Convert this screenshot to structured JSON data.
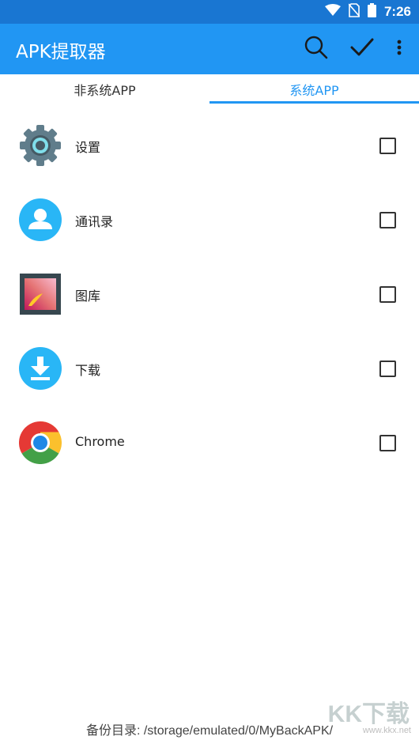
{
  "status_bar": {
    "time": "7:26"
  },
  "app_bar": {
    "title": "APK提取器"
  },
  "tabs": [
    {
      "label": "非系统APP",
      "active": false
    },
    {
      "label": "系统APP",
      "active": true
    }
  ],
  "apps": [
    {
      "name": "设置",
      "icon": "settings-icon",
      "checked": false
    },
    {
      "name": "通讯录",
      "icon": "contacts-icon",
      "checked": false
    },
    {
      "name": "图库",
      "icon": "gallery-icon",
      "checked": false
    },
    {
      "name": "下载",
      "icon": "download-icon",
      "checked": false
    },
    {
      "name": "Chrome",
      "icon": "chrome-icon",
      "checked": false
    }
  ],
  "footer": {
    "backup_dir": "备份目录: /storage/emulated/0/MyBackAPK/"
  },
  "watermark": {
    "big": "KK下载",
    "url": "www.kkx.net"
  },
  "colors": {
    "primary": "#2196f3",
    "status_bar": "#1976d2"
  }
}
